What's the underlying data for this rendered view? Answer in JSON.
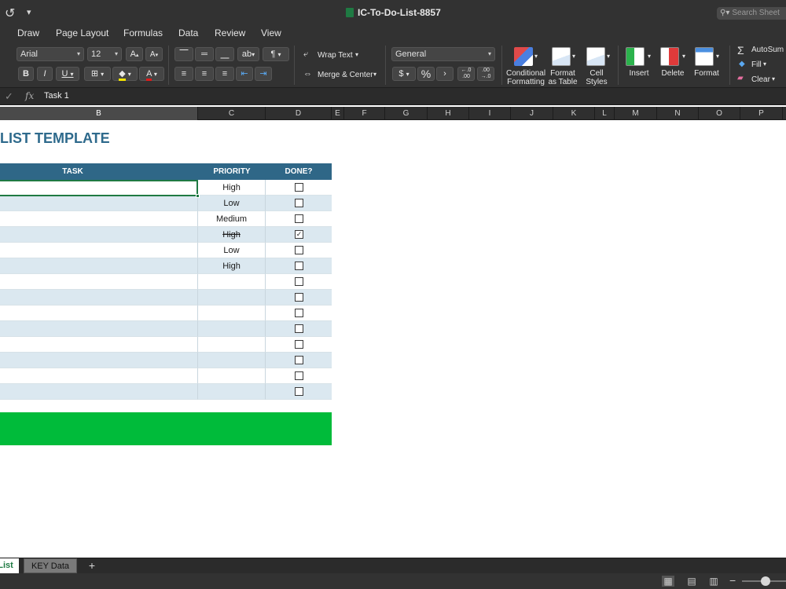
{
  "window": {
    "title": "IC-To-Do-List-8857",
    "search_placeholder": "Search Sheet"
  },
  "ribbon_tabs": [
    "Draw",
    "Page Layout",
    "Formulas",
    "Data",
    "Review",
    "View"
  ],
  "ribbon": {
    "font_name": "Arial",
    "font_size": "12",
    "bold": "B",
    "italic": "I",
    "underline": "U",
    "wrap_text": "Wrap Text",
    "merge_center": "Merge & Center",
    "number_format": "General",
    "currency": "$",
    "percent": "%",
    "comma": "›",
    "conditional_formatting": "Conditional\nFormatting",
    "format_as_table": "Format\nas Table",
    "cell_styles": "Cell\nStyles",
    "insert": "Insert",
    "delete": "Delete",
    "format": "Format",
    "autosum": "AutoSum",
    "fill": "Fill",
    "clear": "Clear"
  },
  "formula_bar": {
    "fx": "fx",
    "content": "Task 1"
  },
  "columns": {
    "B": "B",
    "C": "C",
    "D": "D",
    "E": "E",
    "F": "F",
    "G": "G",
    "H": "H",
    "I": "I",
    "J": "J",
    "K": "K",
    "L": "L",
    "M": "M",
    "N": "N",
    "O": "O",
    "P": "P"
  },
  "sheet": {
    "title": "LIST TEMPLATE",
    "headers": {
      "task": "TASK",
      "priority": "PRIORITY",
      "done": "DONE?"
    },
    "rows": [
      {
        "priority": "High",
        "done": false,
        "strike": false
      },
      {
        "priority": "Low",
        "done": false,
        "strike": false
      },
      {
        "priority": "Medium",
        "done": false,
        "strike": false
      },
      {
        "priority": "High",
        "done": true,
        "strike": true
      },
      {
        "priority": "Low",
        "done": false,
        "strike": false
      },
      {
        "priority": "High",
        "done": false,
        "strike": false
      },
      {
        "priority": "",
        "done": false,
        "strike": false
      },
      {
        "priority": "",
        "done": false,
        "strike": false
      },
      {
        "priority": "",
        "done": false,
        "strike": false
      },
      {
        "priority": "",
        "done": false,
        "strike": false
      },
      {
        "priority": "",
        "done": false,
        "strike": false
      },
      {
        "priority": "",
        "done": false,
        "strike": false
      },
      {
        "priority": "",
        "done": false,
        "strike": false
      },
      {
        "priority": "",
        "done": false,
        "strike": false
      }
    ]
  },
  "sheet_tabs": {
    "list": "List",
    "key_data": "KEY Data",
    "add": "+"
  },
  "colors": {
    "header_blue": "#2f6787",
    "title_blue": "#2e6a8c",
    "alt_row": "#dbe8f0",
    "green_bar": "#00bb3a",
    "chrome": "#323232"
  }
}
